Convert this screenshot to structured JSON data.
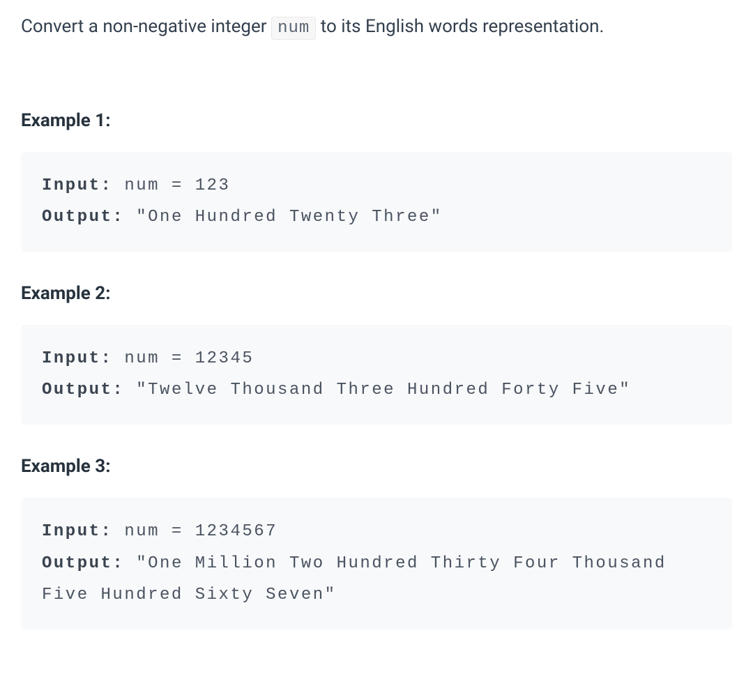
{
  "description": {
    "before": "Convert a non-negative integer ",
    "code": "num",
    "after": " to its English words representation."
  },
  "examples": [
    {
      "heading": "Example 1:",
      "inputLabel": "Input:",
      "inputText": " num = 123",
      "outputLabel": "Output:",
      "outputText": " \"One Hundred Twenty Three\""
    },
    {
      "heading": "Example 2:",
      "inputLabel": "Input:",
      "inputText": " num = 12345",
      "outputLabel": "Output:",
      "outputText": " \"Twelve Thousand Three Hundred Forty Five\""
    },
    {
      "heading": "Example 3:",
      "inputLabel": "Input:",
      "inputText": " num = 1234567",
      "outputLabel": "Output:",
      "outputText": " \"One Million Two Hundred Thirty Four Thousand Five Hundred Sixty Seven\""
    }
  ]
}
